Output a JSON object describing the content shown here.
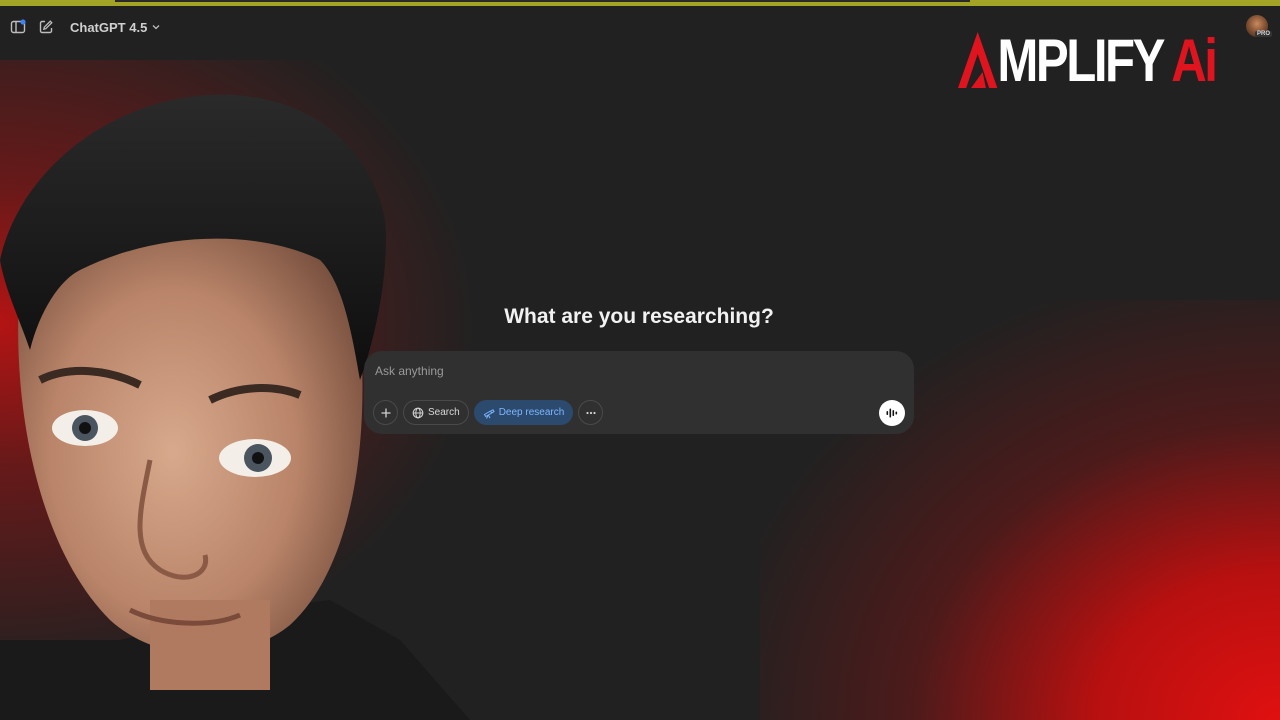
{
  "topbar": {
    "model_name": "ChatGPT 4.5",
    "icons": [
      "sidebar-toggle-icon",
      "new-chat-icon",
      "chevron-down-icon"
    ],
    "profile_badge": "PRO"
  },
  "logo": {
    "text_main": "AMPLIFY",
    "text_accent": "Ai",
    "accent_color": "#e0141e"
  },
  "main": {
    "headline": "What are you researching?",
    "composer": {
      "placeholder": "Ask anything",
      "value": ""
    },
    "tools": {
      "search_label": "Search",
      "deep_research_label": "Deep research"
    }
  },
  "colors": {
    "background": "#212121",
    "composer_bg": "#303030",
    "active_tool_bg": "#2b4a6e",
    "active_tool_text": "#7fb6ff",
    "glow_red": "#d01010"
  }
}
